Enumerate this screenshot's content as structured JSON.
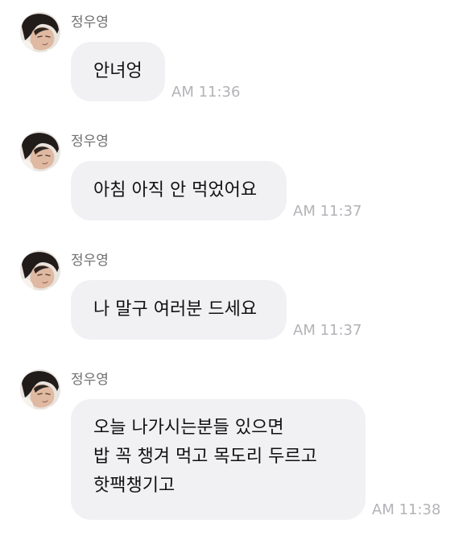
{
  "chat": {
    "messages": [
      {
        "sender": "정우영",
        "lines": [
          "안녀엉"
        ],
        "time": "AM 11:36"
      },
      {
        "sender": "정우영",
        "lines": [
          "아침 아직 안 먹었어요"
        ],
        "time": "AM 11:37"
      },
      {
        "sender": "정우영",
        "lines": [
          "나 말구 여러분 드세요"
        ],
        "time": "AM 11:37"
      },
      {
        "sender": "정우영",
        "lines": [
          "오늘 나가시는분들 있으면",
          "밥 꼭 챙겨 먹고 목도리 두르고",
          "핫팩챙기고"
        ],
        "time": "AM 11:38"
      }
    ]
  }
}
